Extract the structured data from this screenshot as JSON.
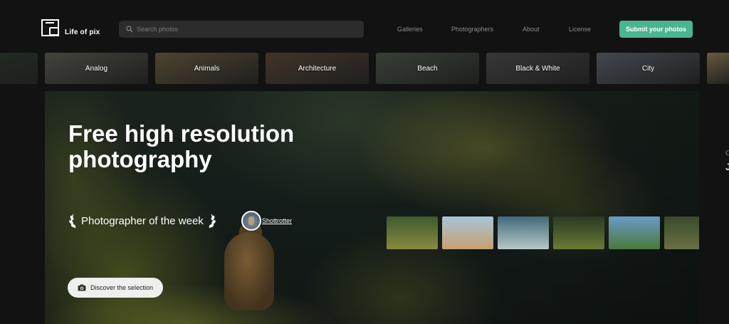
{
  "header": {
    "brand": "Life of pix",
    "search_placeholder": "Search photos",
    "nav": [
      "Galleries",
      "Photographers",
      "About",
      "License"
    ],
    "submit_label": "Submit your photos"
  },
  "categories": [
    {
      "label": "",
      "tone": "#2b3a2e"
    },
    {
      "label": "Analog",
      "tone": "#5b5a50"
    },
    {
      "label": "Animals",
      "tone": "#6a5a40"
    },
    {
      "label": "Architecture",
      "tone": "#5a4536"
    },
    {
      "label": "Beach",
      "tone": "#4a5548"
    },
    {
      "label": "Black & White",
      "tone": "#4a4a4a"
    },
    {
      "label": "City",
      "tone": "#5a6068"
    },
    {
      "label": "",
      "tone": "#8a7a50"
    }
  ],
  "hero": {
    "title": "Free high resolution photography",
    "potw_label": "Photographer of the week",
    "photographer": "Shottrotter",
    "discover_label": "Discover the selection",
    "thumbs": [
      {
        "name": "thumb-cliff",
        "colors": [
          "#3d5a2e",
          "#8a8a40"
        ]
      },
      {
        "name": "thumb-beach",
        "colors": [
          "#a8c4d8",
          "#c7a070"
        ]
      },
      {
        "name": "thumb-gull",
        "colors": [
          "#3f6a78",
          "#b8c8c8"
        ]
      },
      {
        "name": "thumb-slope",
        "colors": [
          "#2a3a24",
          "#6a7a34"
        ]
      },
      {
        "name": "thumb-hillside",
        "colors": [
          "#6a9ac8",
          "#4a7a3a"
        ]
      },
      {
        "name": "thumb-meadow",
        "colors": [
          "#3a4a2a",
          "#6a7044"
        ]
      }
    ]
  },
  "edge": {
    "small": "C",
    "large": "J"
  },
  "colors": {
    "accent": "#4bb591",
    "background": "#121212"
  }
}
